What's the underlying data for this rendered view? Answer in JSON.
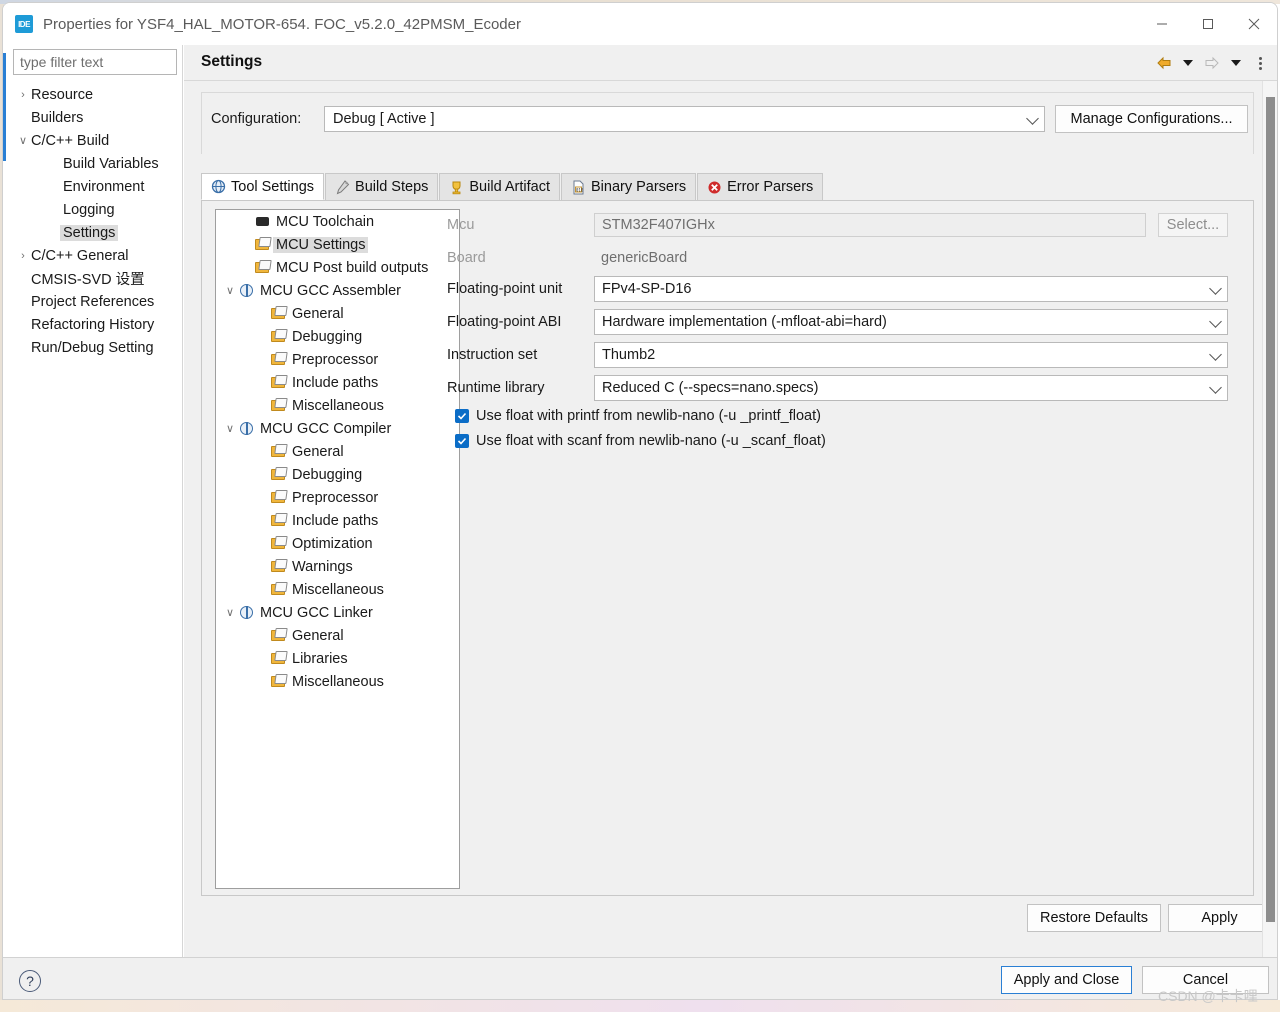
{
  "window": {
    "title": "Properties for YSF4_HAL_MOTOR-654. FOC_v5.2.0_42PMSM_Ecoder",
    "app_icon_label": "IDE",
    "minimize_glyph": "—",
    "maximize_glyph": "□",
    "close_glyph": "✕"
  },
  "sidebar": {
    "filter_placeholder": "type filter text",
    "items": [
      {
        "label": "Resource",
        "indent": 0,
        "twisty": "›",
        "selected": false
      },
      {
        "label": "Builders",
        "indent": 0,
        "twisty": "",
        "selected": false
      },
      {
        "label": "C/C++ Build",
        "indent": 0,
        "twisty": "∨",
        "selected": false
      },
      {
        "label": "Build Variables",
        "indent": 1,
        "twisty": "",
        "selected": false
      },
      {
        "label": "Environment",
        "indent": 1,
        "twisty": "",
        "selected": false
      },
      {
        "label": "Logging",
        "indent": 1,
        "twisty": "",
        "selected": false
      },
      {
        "label": "Settings",
        "indent": 1,
        "twisty": "",
        "selected": true
      },
      {
        "label": "C/C++ General",
        "indent": 0,
        "twisty": "›",
        "selected": false
      },
      {
        "label": "CMSIS-SVD 设置",
        "indent": 0,
        "twisty": "",
        "selected": false
      },
      {
        "label": "Project References",
        "indent": 0,
        "twisty": "",
        "selected": false
      },
      {
        "label": "Refactoring History",
        "indent": 0,
        "twisty": "",
        "selected": false
      },
      {
        "label": "Run/Debug Setting",
        "indent": 0,
        "twisty": "",
        "selected": false
      }
    ]
  },
  "header": {
    "title": "Settings",
    "back_icon": "back-arrow-icon",
    "forward_icon": "forward-arrow-icon",
    "menu_icon": "vertical-dots-icon"
  },
  "configuration": {
    "label": "Configuration:",
    "value": "Debug  [ Active ]",
    "manage_label": "Manage Configurations..."
  },
  "tabs": [
    {
      "label": "Tool Settings",
      "icon": "globe-icon",
      "active": true
    },
    {
      "label": "Build Steps",
      "icon": "wrench-icon",
      "active": false
    },
    {
      "label": "Build Artifact",
      "icon": "trophy-icon",
      "active": false
    },
    {
      "label": "Binary Parsers",
      "icon": "file-icon",
      "active": false
    },
    {
      "label": "Error Parsers",
      "icon": "error-icon",
      "active": false
    }
  ],
  "tool_tree": [
    {
      "label": "MCU Toolchain",
      "indent": 1,
      "twisty": "",
      "icon": "chip",
      "selected": false
    },
    {
      "label": "MCU Settings",
      "indent": 1,
      "twisty": "",
      "icon": "folder",
      "selected": true
    },
    {
      "label": "MCU Post build outputs",
      "indent": 1,
      "twisty": "",
      "icon": "folder",
      "selected": false
    },
    {
      "label": "MCU GCC Assembler",
      "indent": 0,
      "twisty": "∨",
      "icon": "globe",
      "selected": false
    },
    {
      "label": "General",
      "indent": 2,
      "twisty": "",
      "icon": "folder",
      "selected": false
    },
    {
      "label": "Debugging",
      "indent": 2,
      "twisty": "",
      "icon": "folder",
      "selected": false
    },
    {
      "label": "Preprocessor",
      "indent": 2,
      "twisty": "",
      "icon": "folder",
      "selected": false
    },
    {
      "label": "Include paths",
      "indent": 2,
      "twisty": "",
      "icon": "folder",
      "selected": false
    },
    {
      "label": "Miscellaneous",
      "indent": 2,
      "twisty": "",
      "icon": "folder",
      "selected": false
    },
    {
      "label": "MCU GCC Compiler",
      "indent": 0,
      "twisty": "∨",
      "icon": "globe",
      "selected": false
    },
    {
      "label": "General",
      "indent": 2,
      "twisty": "",
      "icon": "folder",
      "selected": false
    },
    {
      "label": "Debugging",
      "indent": 2,
      "twisty": "",
      "icon": "folder",
      "selected": false
    },
    {
      "label": "Preprocessor",
      "indent": 2,
      "twisty": "",
      "icon": "folder",
      "selected": false
    },
    {
      "label": "Include paths",
      "indent": 2,
      "twisty": "",
      "icon": "folder",
      "selected": false
    },
    {
      "label": "Optimization",
      "indent": 2,
      "twisty": "",
      "icon": "folder",
      "selected": false
    },
    {
      "label": "Warnings",
      "indent": 2,
      "twisty": "",
      "icon": "folder",
      "selected": false
    },
    {
      "label": "Miscellaneous",
      "indent": 2,
      "twisty": "",
      "icon": "folder",
      "selected": false
    },
    {
      "label": "MCU GCC Linker",
      "indent": 0,
      "twisty": "∨",
      "icon": "globe",
      "selected": false
    },
    {
      "label": "General",
      "indent": 2,
      "twisty": "",
      "icon": "folder",
      "selected": false
    },
    {
      "label": "Libraries",
      "indent": 2,
      "twisty": "",
      "icon": "folder",
      "selected": false
    },
    {
      "label": "Miscellaneous",
      "indent": 2,
      "twisty": "",
      "icon": "folder",
      "selected": false
    }
  ],
  "form": {
    "mcu": {
      "label": "Mcu",
      "value": "STM32F407IGHx",
      "button": "Select..."
    },
    "board": {
      "label": "Board",
      "value": "genericBoard"
    },
    "fpu": {
      "label": "Floating-point unit",
      "value": "FPv4-SP-D16"
    },
    "fpabi": {
      "label": "Floating-point ABI",
      "value": "Hardware implementation (-mfloat-abi=hard)"
    },
    "iset": {
      "label": "Instruction set",
      "value": "Thumb2"
    },
    "rtlib": {
      "label": "Runtime library",
      "value": "Reduced C (--specs=nano.specs)"
    },
    "checkboxes": [
      {
        "label": "Use float with printf from newlib-nano (-u _printf_float)",
        "checked": true
      },
      {
        "label": "Use float with scanf from newlib-nano (-u _scanf_float)",
        "checked": true
      }
    ]
  },
  "buttons": {
    "restore_defaults": "Restore Defaults",
    "apply": "Apply",
    "apply_and_close": "Apply and Close",
    "cancel": "Cancel"
  },
  "footer": {
    "help_glyph": "?"
  },
  "watermark": "CSDN @卡卡哩",
  "colors": {
    "accent": "#2a7fd4",
    "checkbox": "#0b6dc7",
    "selection": "#dcdcdc",
    "title_icon": "#1e9bd7"
  }
}
